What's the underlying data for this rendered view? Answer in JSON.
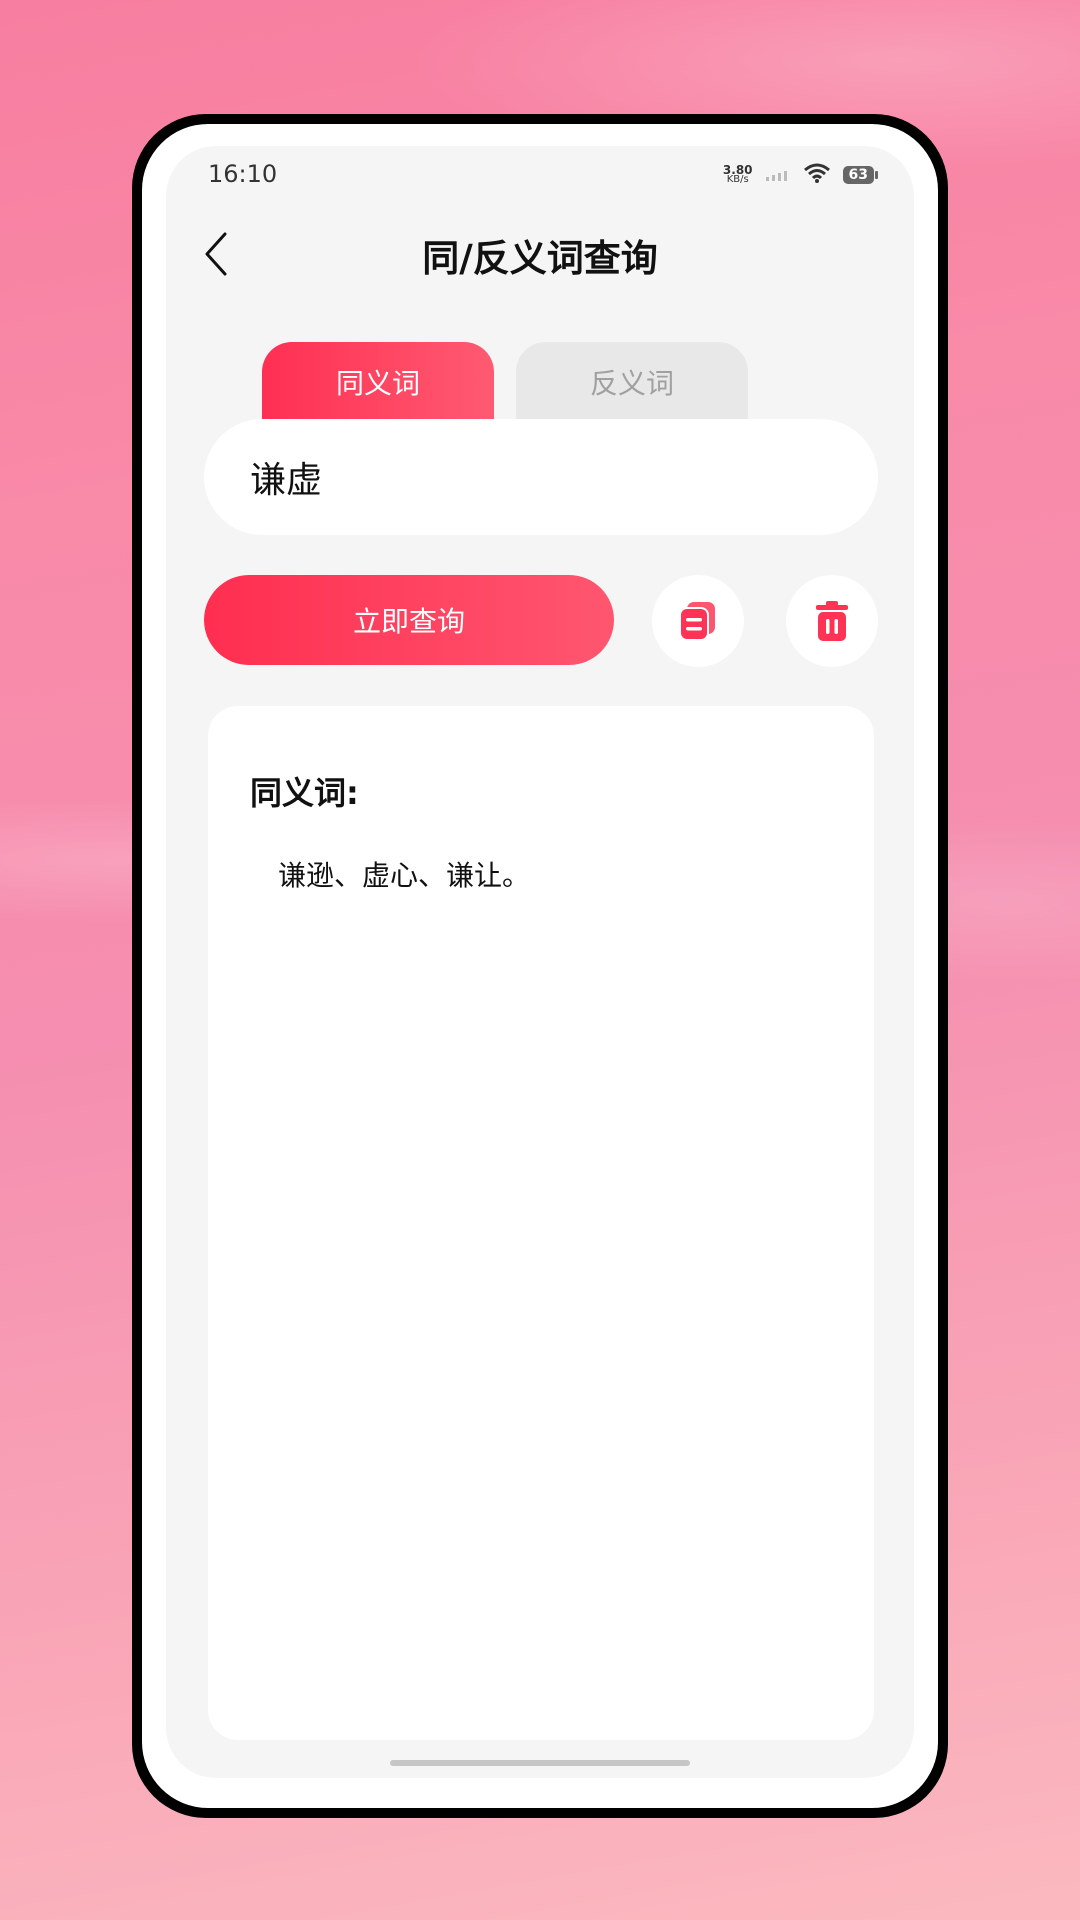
{
  "status_bar": {
    "time": "16:10",
    "net_speed_value": "3.80",
    "net_speed_unit": "KB/s",
    "battery": "63"
  },
  "header": {
    "title": "同/反义词查询",
    "back_icon": "chevron-left-icon"
  },
  "tabs": [
    {
      "label": "同义词",
      "active": true
    },
    {
      "label": "反义词",
      "active": false
    }
  ],
  "search": {
    "value": "谦虚"
  },
  "actions": {
    "query_label": "立即查询",
    "copy_icon": "copy-icon",
    "delete_icon": "trash-icon"
  },
  "result": {
    "heading": "同义词:",
    "text": "谦逊、虚心、谦让。"
  },
  "colors": {
    "accent": "#ff3355",
    "tab_inactive_bg": "#e8e8e8",
    "screen_bg": "#f5f5f5"
  }
}
